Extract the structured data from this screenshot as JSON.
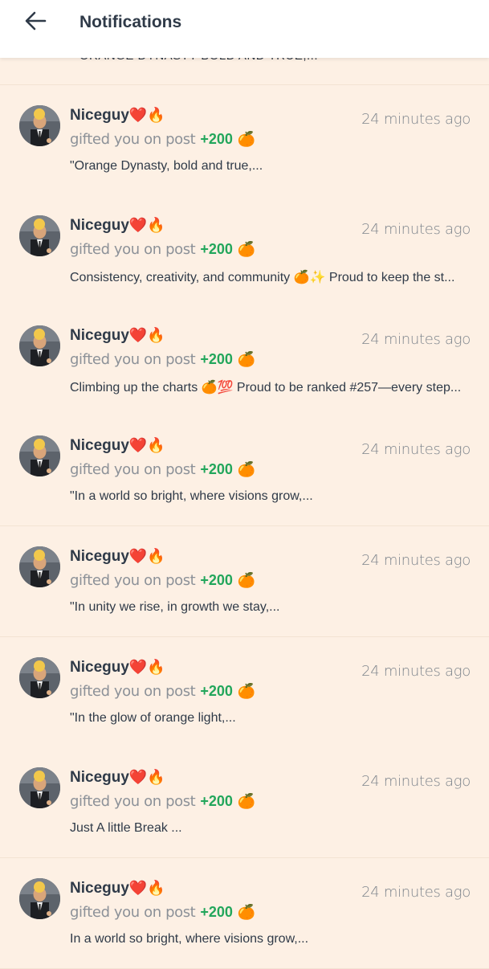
{
  "header": {
    "title": "Notifications",
    "back_icon": "arrow-left-icon"
  },
  "partial_item": {
    "post_text": "\"ORANGE DYNASTY BOLD AND TRUE,..."
  },
  "notifications": [
    {
      "name": "Niceguy",
      "name_emoji": "❤️🔥",
      "time": "24 minutes ago",
      "action": "gifted you on post",
      "amount": "+200",
      "coin": "🍊",
      "post": "\"Orange Dynasty, bold and true,..."
    },
    {
      "name": "Niceguy",
      "name_emoji": "❤️🔥",
      "time": "24 minutes ago",
      "action": "gifted you on post",
      "amount": "+200",
      "coin": "🍊",
      "post": "Consistency, creativity, and community 🍊✨ Proud to keep the st..."
    },
    {
      "name": "Niceguy",
      "name_emoji": "❤️🔥",
      "time": "24 minutes ago",
      "action": "gifted you on post",
      "amount": "+200",
      "coin": "🍊",
      "post": "Climbing up the charts 🍊💯 Proud to be ranked #257—every step..."
    },
    {
      "name": "Niceguy",
      "name_emoji": "❤️🔥",
      "time": "24 minutes ago",
      "action": "gifted you on post",
      "amount": "+200",
      "coin": "🍊",
      "post": "\"In a world so bright, where visions grow,..."
    },
    {
      "name": "Niceguy",
      "name_emoji": "❤️🔥",
      "time": "24 minutes ago",
      "action": "gifted you on post",
      "amount": "+200",
      "coin": "🍊",
      "post": "\"In unity we rise, in growth we stay,..."
    },
    {
      "name": "Niceguy",
      "name_emoji": "❤️🔥",
      "time": "24 minutes ago",
      "action": "gifted you on post",
      "amount": "+200",
      "coin": "🍊",
      "post": "\"In the glow of orange light,..."
    },
    {
      "name": "Niceguy",
      "name_emoji": "❤️🔥",
      "time": "24 minutes ago",
      "action": "gifted you on post",
      "amount": "+200",
      "coin": "🍊",
      "post": "Just A little Break ..."
    },
    {
      "name": "Niceguy",
      "name_emoji": "❤️🔥",
      "time": "24 minutes ago",
      "action": "gifted you on post",
      "amount": "+200",
      "coin": "🍊",
      "post": "In a world so bright, where visions grow,..."
    }
  ],
  "colors": {
    "background": "#fdf0e4",
    "header_bg": "#ffffff",
    "text_dark": "#2f3a48",
    "text_muted": "#8c9198",
    "amount_green": "#22a65b"
  }
}
